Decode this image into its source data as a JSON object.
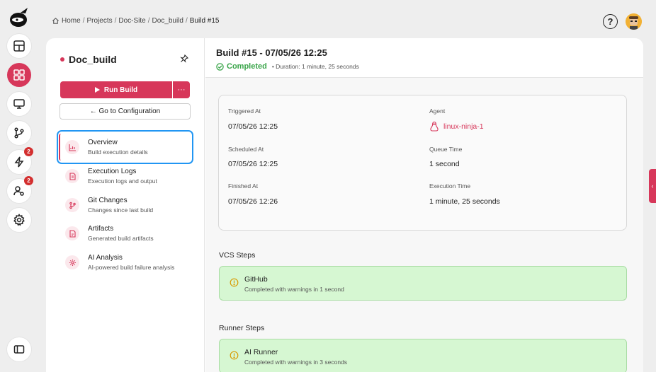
{
  "breadcrumb": {
    "home": "Home",
    "projects": "Projects",
    "site": "Doc-Site",
    "build_config": "Doc_build",
    "current": "Build #15",
    "separator": "/"
  },
  "header": {
    "help": "?"
  },
  "rail": {
    "icons": [
      "logo-icon",
      "dashboard-icon",
      "projects-grid-icon",
      "monitor-icon",
      "git-branch-icon",
      "lightning-icon",
      "user-settings-icon",
      "gear-icon",
      "sidebar-toggle-icon"
    ],
    "badges": {
      "lightning": "2",
      "users": "2"
    },
    "active_color": "#d7375a"
  },
  "project": {
    "name": "Doc_build",
    "run_label": "Run Build",
    "more_label": "···",
    "config_label": "← Go to Configuration"
  },
  "nav": [
    {
      "title": "Overview",
      "sub": "Build execution details"
    },
    {
      "title": "Execution Logs",
      "sub": "Execution logs and output"
    },
    {
      "title": "Git Changes",
      "sub": "Changes since last build"
    },
    {
      "title": "Artifacts",
      "sub": "Generated build artifacts"
    },
    {
      "title": "AI Analysis",
      "sub": "AI-powered build failure analysis"
    }
  ],
  "build": {
    "title": "Build #15 - 07/05/26 12:25",
    "status": "Completed",
    "duration": "• Duration: 1 minute, 25 seconds",
    "status_color": "#3aa54a"
  },
  "info": {
    "triggered_label": "Triggered At",
    "triggered_value": "07/05/26 12:25",
    "agent_label": "Agent",
    "agent_value": "linux-ninja-1",
    "scheduled_label": "Scheduled At",
    "scheduled_value": "07/05/26 12:25",
    "queue_label": "Queue Time",
    "queue_value": "1 second",
    "finished_label": "Finished At",
    "finished_value": "07/05/26 12:26",
    "exec_label": "Execution Time",
    "exec_value": "1 minute, 25 seconds"
  },
  "vcs": {
    "title": "VCS Steps",
    "steps": [
      {
        "name": "GitHub",
        "sub": "Completed with warnings in 1 second"
      }
    ]
  },
  "runner": {
    "title": "Runner Steps",
    "steps": [
      {
        "name": "AI Runner",
        "sub": "Completed with warnings in 3 seconds"
      }
    ]
  },
  "side_tab": "‹"
}
